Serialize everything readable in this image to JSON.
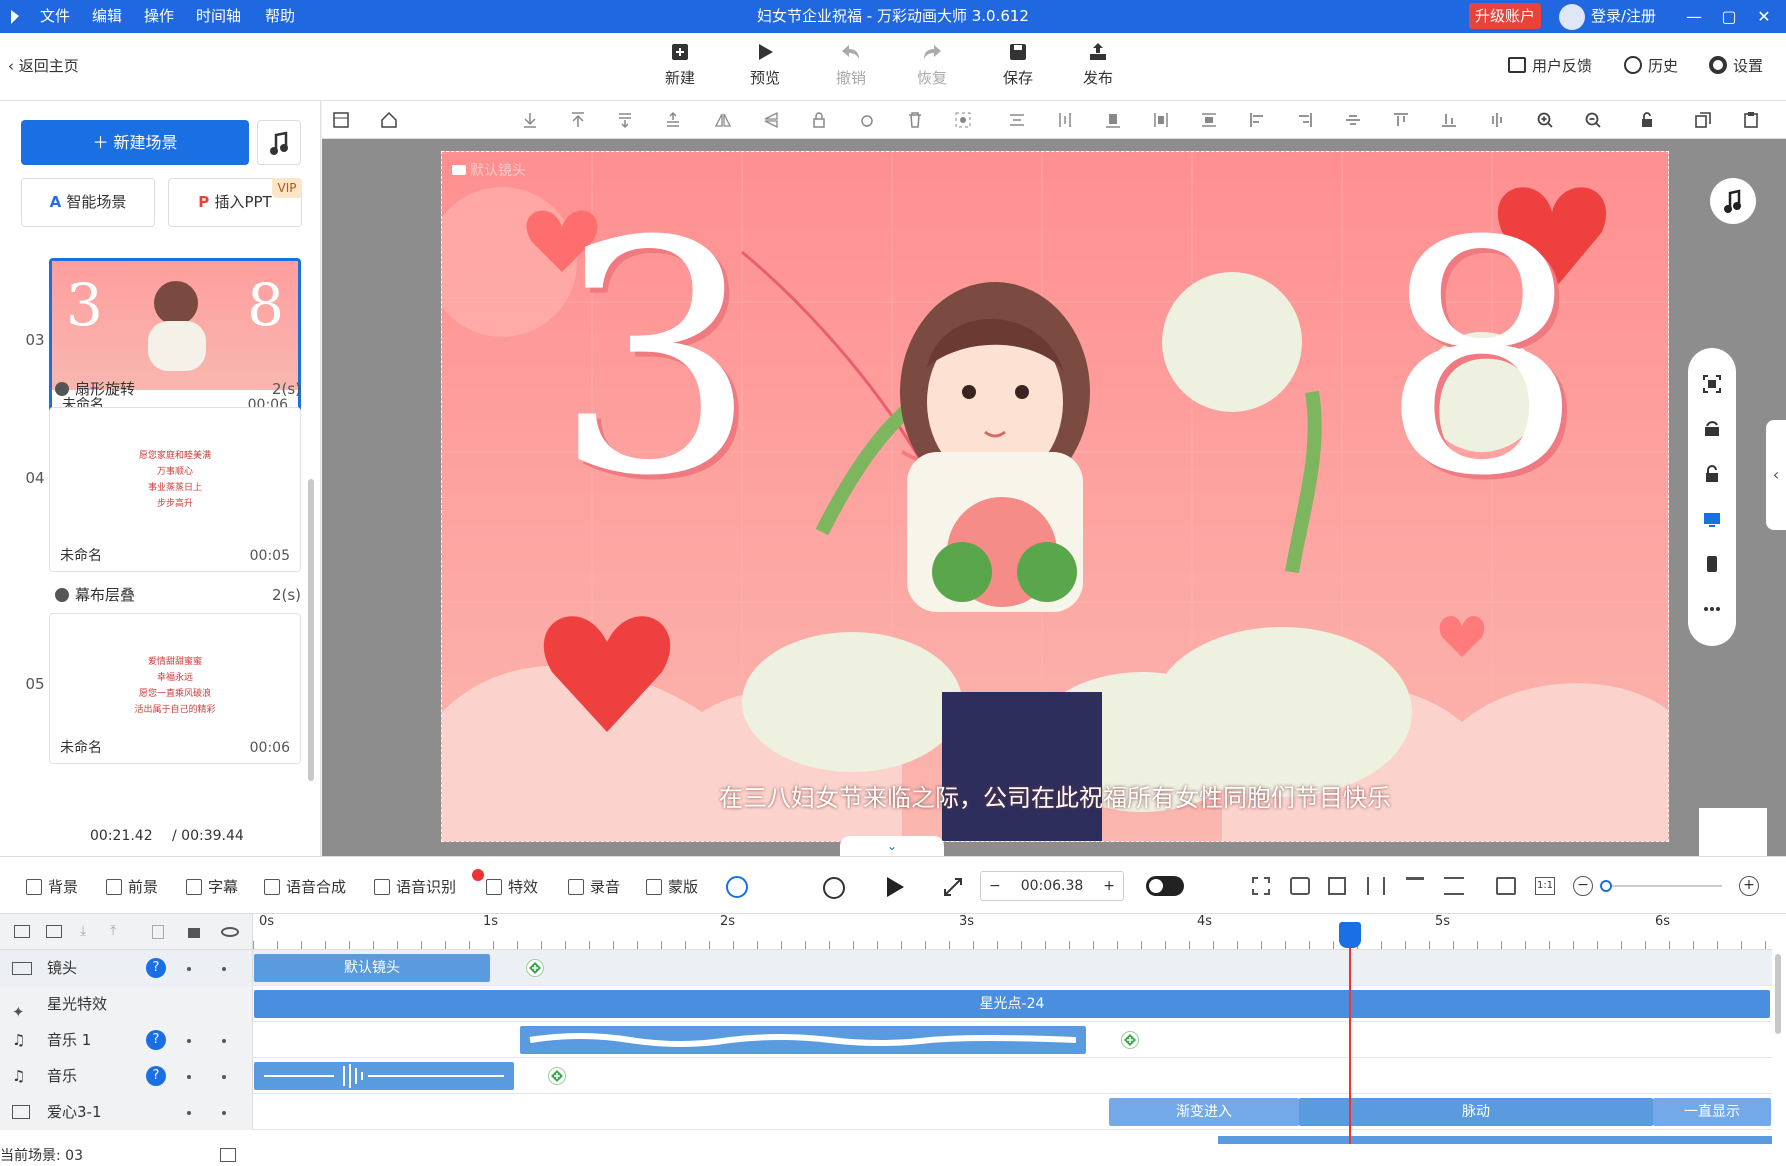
{
  "titlebar": {
    "menus": [
      "文件",
      "编辑",
      "操作",
      "时间轴",
      "帮助"
    ],
    "title": "妇女节企业祝福 - 万彩动画大师 3.0.612",
    "upgrade": "升级账户",
    "login": "登录/注册"
  },
  "toolbar": {
    "back": "返回主页",
    "buttons": [
      {
        "label": "新建",
        "icon": "new-icon"
      },
      {
        "label": "预览",
        "icon": "play-icon"
      },
      {
        "label": "撤销",
        "icon": "undo-icon"
      },
      {
        "label": "恢复",
        "icon": "redo-icon"
      },
      {
        "label": "保存",
        "icon": "save-icon"
      },
      {
        "label": "发布",
        "icon": "publish-icon"
      }
    ],
    "right": [
      {
        "label": "用户反馈",
        "icon": "feedback-icon"
      },
      {
        "label": "历史",
        "icon": "history-icon"
      },
      {
        "label": "设置",
        "icon": "gear-icon"
      }
    ]
  },
  "left": {
    "new_scene": "新建场景",
    "smart_scene": "智能场景",
    "insert_ppt": "插入PPT",
    "vip": "VIP",
    "scenes": [
      {
        "num": "03",
        "name": "未命名",
        "time": "00:06",
        "transition": "扇形旋转",
        "trans_dur": "2(s)"
      },
      {
        "num": "04",
        "name": "未命名",
        "time": "00:05",
        "transition": "幕布层叠",
        "trans_dur": "2(s)",
        "lines": [
          "愿您家庭和睦美满",
          "万事顺心",
          "事业蒸蒸日上",
          "步步高升"
        ]
      },
      {
        "num": "05",
        "name": "未命名",
        "time": "00:06",
        "lines": [
          "爱情甜甜蜜蜜",
          "幸福永远",
          "愿您一直乘风破浪",
          "活出属于自己的精彩"
        ]
      }
    ],
    "current_time": "00:21.42",
    "total_time": "/ 00:39.44"
  },
  "stage": {
    "camera_label": "默认镜头",
    "subtitle": "在三八妇女节来临之际，公司在此祝福所有女性同胞们节目快乐",
    "big_left": "3",
    "big_right": "8"
  },
  "controls": {
    "items": [
      "背景",
      "前景",
      "字幕",
      "语音合成",
      "语音识别",
      "特效",
      "录音",
      "蒙版"
    ],
    "time": "00:06.38",
    "ratio": "1:1"
  },
  "timeline": {
    "ticks": [
      "0s",
      "1s",
      "2s",
      "3s",
      "4s",
      "5s",
      "6s"
    ],
    "tracks": [
      {
        "name": "镜头",
        "clips": [
          "默认镜头"
        ]
      },
      {
        "name": "星光特效",
        "clips": [
          "星光点-24"
        ]
      },
      {
        "name": "音乐 1",
        "clips": []
      },
      {
        "name": "音乐",
        "clips": []
      },
      {
        "name": "爱心3-1",
        "clips": [
          "渐变进入",
          "脉动",
          "一直显示"
        ]
      }
    ],
    "current_scene": "当前场景: 03"
  }
}
